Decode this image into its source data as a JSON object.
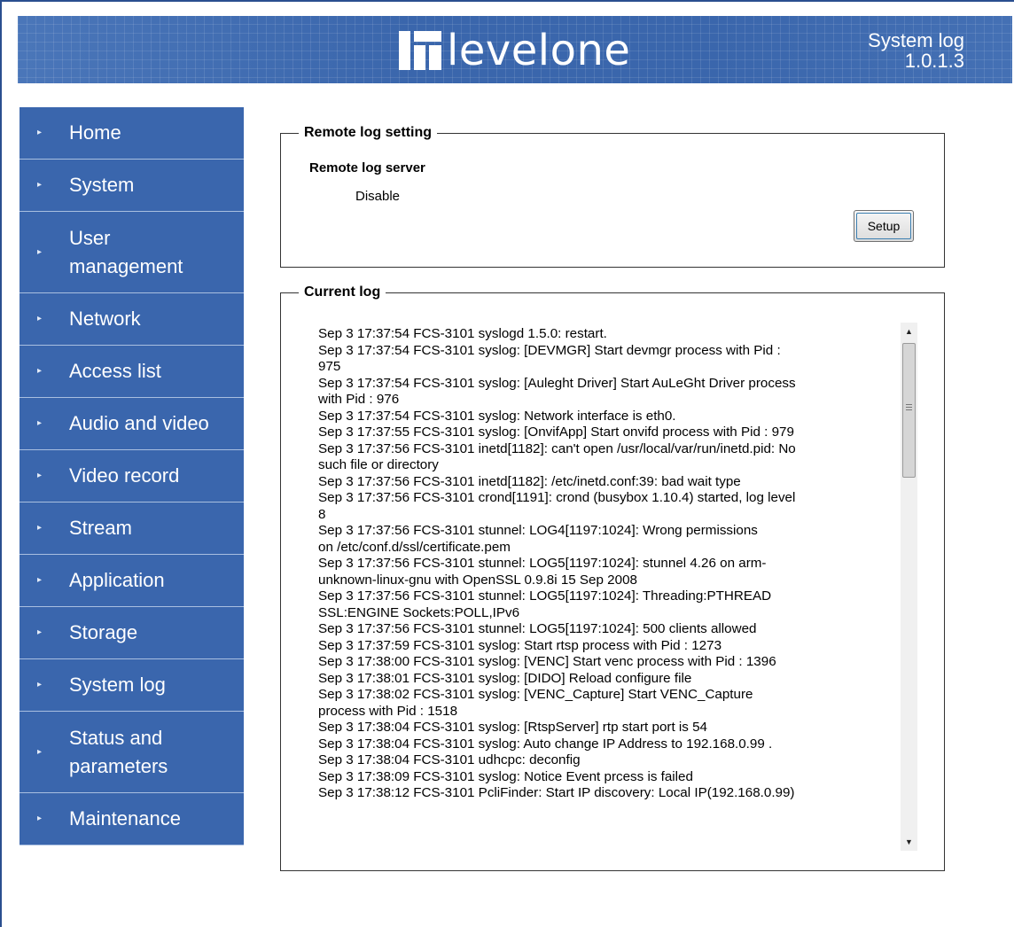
{
  "header": {
    "brand": "levelone",
    "page_title": "System log",
    "version": "1.0.1.3"
  },
  "sidebar": {
    "items": [
      {
        "label": "Home"
      },
      {
        "label": "System"
      },
      {
        "label": "User management",
        "lines": [
          "User",
          "management"
        ]
      },
      {
        "label": "Network"
      },
      {
        "label": "Access list"
      },
      {
        "label": "Audio and video"
      },
      {
        "label": "Video record"
      },
      {
        "label": "Stream"
      },
      {
        "label": "Application"
      },
      {
        "label": "Storage"
      },
      {
        "label": "System log"
      },
      {
        "label": "Status and parameters",
        "lines": [
          "Status and",
          "parameters"
        ]
      },
      {
        "label": "Maintenance"
      }
    ]
  },
  "remote_log": {
    "legend": "Remote log setting",
    "server_label": "Remote log server",
    "server_value": "Disable",
    "setup_button": "Setup"
  },
  "current_log": {
    "legend": "Current log",
    "lines": [
      "Sep 3 17:37:54 FCS-3101 syslogd 1.5.0: restart.",
      "Sep 3 17:37:54 FCS-3101 syslog: [DEVMGR] Start devmgr process with Pid :",
      "975",
      "Sep 3 17:37:54 FCS-3101 syslog: [Auleght Driver] Start AuLeGht Driver process",
      "with Pid : 976",
      "Sep 3 17:37:54 FCS-3101 syslog: Network interface is eth0.",
      "Sep 3 17:37:55 FCS-3101 syslog: [OnvifApp] Start onvifd process with Pid : 979",
      "Sep 3 17:37:56 FCS-3101 inetd[1182]: can't open /usr/local/var/run/inetd.pid: No",
      "such file or directory",
      "Sep 3 17:37:56 FCS-3101 inetd[1182]: /etc/inetd.conf:39: bad wait type",
      "Sep 3 17:37:56 FCS-3101 crond[1191]: crond (busybox 1.10.4) started, log level",
      "8",
      "Sep 3 17:37:56 FCS-3101 stunnel: LOG4[1197:1024]: Wrong permissions",
      "on /etc/conf.d/ssl/certificate.pem",
      "Sep 3 17:37:56 FCS-3101 stunnel: LOG5[1197:1024]: stunnel 4.26 on arm-",
      "unknown-linux-gnu with OpenSSL 0.9.8i 15 Sep 2008",
      "Sep 3 17:37:56 FCS-3101 stunnel: LOG5[1197:1024]: Threading:PTHREAD",
      "SSL:ENGINE Sockets:POLL,IPv6",
      "Sep 3 17:37:56 FCS-3101 stunnel: LOG5[1197:1024]: 500 clients allowed",
      "Sep 3 17:37:59 FCS-3101 syslog: Start rtsp process with Pid : 1273",
      "Sep 3 17:38:00 FCS-3101 syslog: [VENC] Start venc process with Pid : 1396",
      "Sep 3 17:38:01 FCS-3101 syslog: [DIDO] Reload configure file",
      "Sep 3 17:38:02 FCS-3101 syslog: [VENC_Capture] Start VENC_Capture",
      "process with Pid : 1518",
      "Sep 3 17:38:04 FCS-3101 syslog: [RtspServer] rtp start port is 54",
      "Sep 3 17:38:04 FCS-3101 syslog: Auto change IP Address to 192.168.0.99 .",
      "Sep 3 17:38:04 FCS-3101 udhcpc: deconfig",
      "Sep 3 17:38:09 FCS-3101 syslog: Notice Event prcess is failed",
      "Sep 3 17:38:12 FCS-3101 PcliFinder: Start IP discovery: Local IP(192.168.0.99)"
    ]
  },
  "colors": {
    "banner": "#3d6ab0",
    "nav_bg": "#3a66ad",
    "nav_divider": "#a9bfe0",
    "text_on_blue": "#ffffff"
  },
  "icons": {
    "nav_arrow": "triangle-right-icon",
    "logo": "levelone-logo-icon"
  }
}
